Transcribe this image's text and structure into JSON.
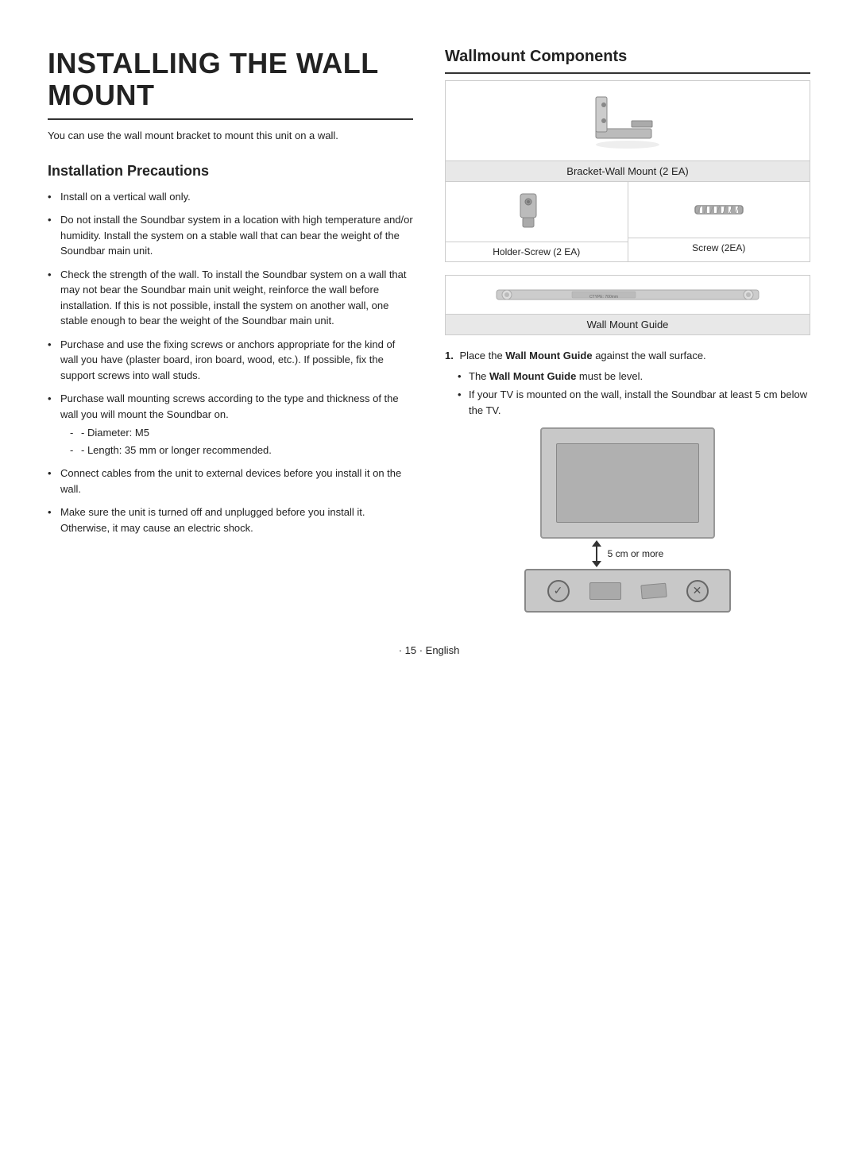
{
  "page": {
    "title": "INSTALLING THE WALL MOUNT",
    "intro": "You can use the wall mount bracket to mount this unit on a wall.",
    "left": {
      "section_title": "Installation Precautions",
      "precautions": [
        {
          "text": "Install on a vertical wall only.",
          "sub": []
        },
        {
          "text": "Do not install the Soundbar system in a location with high temperature and/or humidity. Install the system on a stable wall that can bear the weight of the Soundbar main unit.",
          "sub": []
        },
        {
          "text": "Check the strength of the wall. To install the Soundbar system on a wall that may not bear the Soundbar main unit weight, reinforce the wall before installation. If this is not possible, install the system on another wall, one stable enough to bear the weight of the Soundbar main unit.",
          "sub": []
        },
        {
          "text": "Purchase and use the fixing screws or anchors appropriate for the kind of wall you have (plaster board, iron board, wood, etc.). If possible, fix the support screws into wall studs.",
          "sub": []
        },
        {
          "text": "Purchase wall mounting screws according to the type and thickness of the wall you will mount the Soundbar on.",
          "sub": [
            "- Diameter: M5",
            "- Length: 35 mm or longer recommended."
          ]
        },
        {
          "text": "Connect cables from the unit to external devices before you install it on the wall.",
          "sub": []
        },
        {
          "text": "Make sure the unit is turned off and unplugged before you install it. Otherwise, it may cause an electric shock.",
          "sub": []
        }
      ]
    },
    "right": {
      "section_title": "Wallmount Components",
      "bracket_label": "Bracket-Wall Mount (2 EA)",
      "holder_label": "Holder-Screw (2 EA)",
      "screw_label": "Screw (2EA)",
      "guide_label": "Wall Mount Guide",
      "guide_text_label": "Wall Mount Guide",
      "step1": {
        "number": "1.",
        "bold_text": "Wall Mount Guide",
        "pre_text": "Place the",
        "post_text": "against the wall surface.",
        "sub_items": [
          {
            "bold": "Wall Mount Guide",
            "pre": "The",
            "post": "must be level."
          },
          {
            "bold": "",
            "pre": "If your TV is mounted on the wall, install the Soundbar at least 5 cm below the TV.",
            "post": ""
          }
        ]
      },
      "cm_label": "5 cm or more"
    },
    "footer": "· 15 · English"
  }
}
